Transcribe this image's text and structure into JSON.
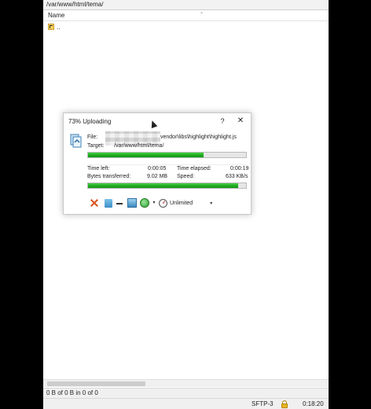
{
  "window": {
    "path": "/var/www/html/tema/",
    "column_name": "Name",
    "parent_dir_label": "..",
    "status_left": "0 B of 0 B in 0 of 0",
    "protocol": "SFTP-3",
    "session_time": "0:18:20"
  },
  "dialog": {
    "title": "73% Uploading",
    "file_label": "File:",
    "file_value": "vendor\\libs\\highlight\\highlight.js",
    "target_label": "Target:",
    "target_value": "/var/www/html/tema/",
    "file_progress": 0.73,
    "time_left_label": "Time left:",
    "time_left_value": "0:00:05",
    "time_elapsed_label": "Time elapsed:",
    "time_elapsed_value": "0:00:19",
    "bytes_label": "Bytes transferred:",
    "bytes_value": "9.02 MB",
    "speed_label": "Speed:",
    "speed_value": "633 KB/s",
    "total_progress": 0.95,
    "help_glyph": "?",
    "close_glyph": "✕",
    "speed_limit": "Unlimited",
    "icons": [
      "cancel-icon",
      "move-to-background-icon",
      "minimize-icon",
      "queue-icon",
      "speed-icon",
      "gauge-icon"
    ]
  },
  "colors": {
    "progress_green": "#1faa1f",
    "cancel_red": "#d9531e"
  }
}
